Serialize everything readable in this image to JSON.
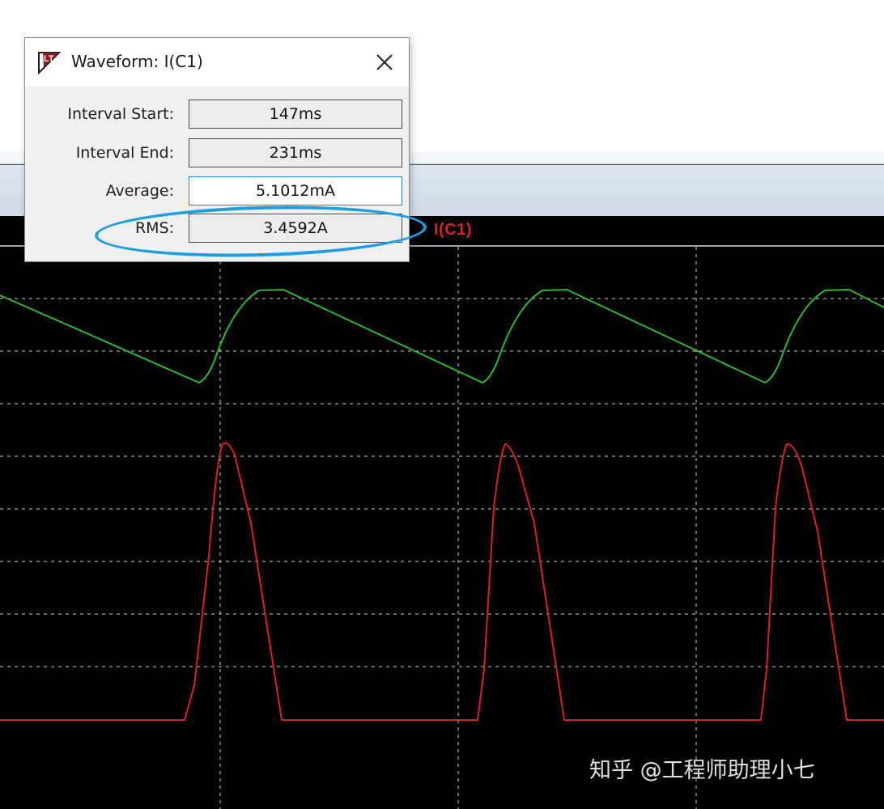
{
  "dialog": {
    "title": "Waveform: I(C1)",
    "fields": {
      "interval_start": {
        "label": "Interval Start:",
        "value": "147ms"
      },
      "interval_end": {
        "label": "Interval End:",
        "value": "231ms"
      },
      "average": {
        "label": "Average:",
        "value": "5.1012mA"
      },
      "rms": {
        "label": "RMS:",
        "value": "3.4592A"
      }
    },
    "highlighted_field": "RMS"
  },
  "plot": {
    "trace_label": "I(C1)",
    "trace_color": "#d62222",
    "secondary_trace_color": "#2fb52f",
    "background": "#000000",
    "grid": "dashed"
  },
  "watermark": "知乎 @工程师助理小七",
  "colors": {
    "highlight_ring": "#1e9ee0",
    "window_bg": "#f0f0f0"
  }
}
